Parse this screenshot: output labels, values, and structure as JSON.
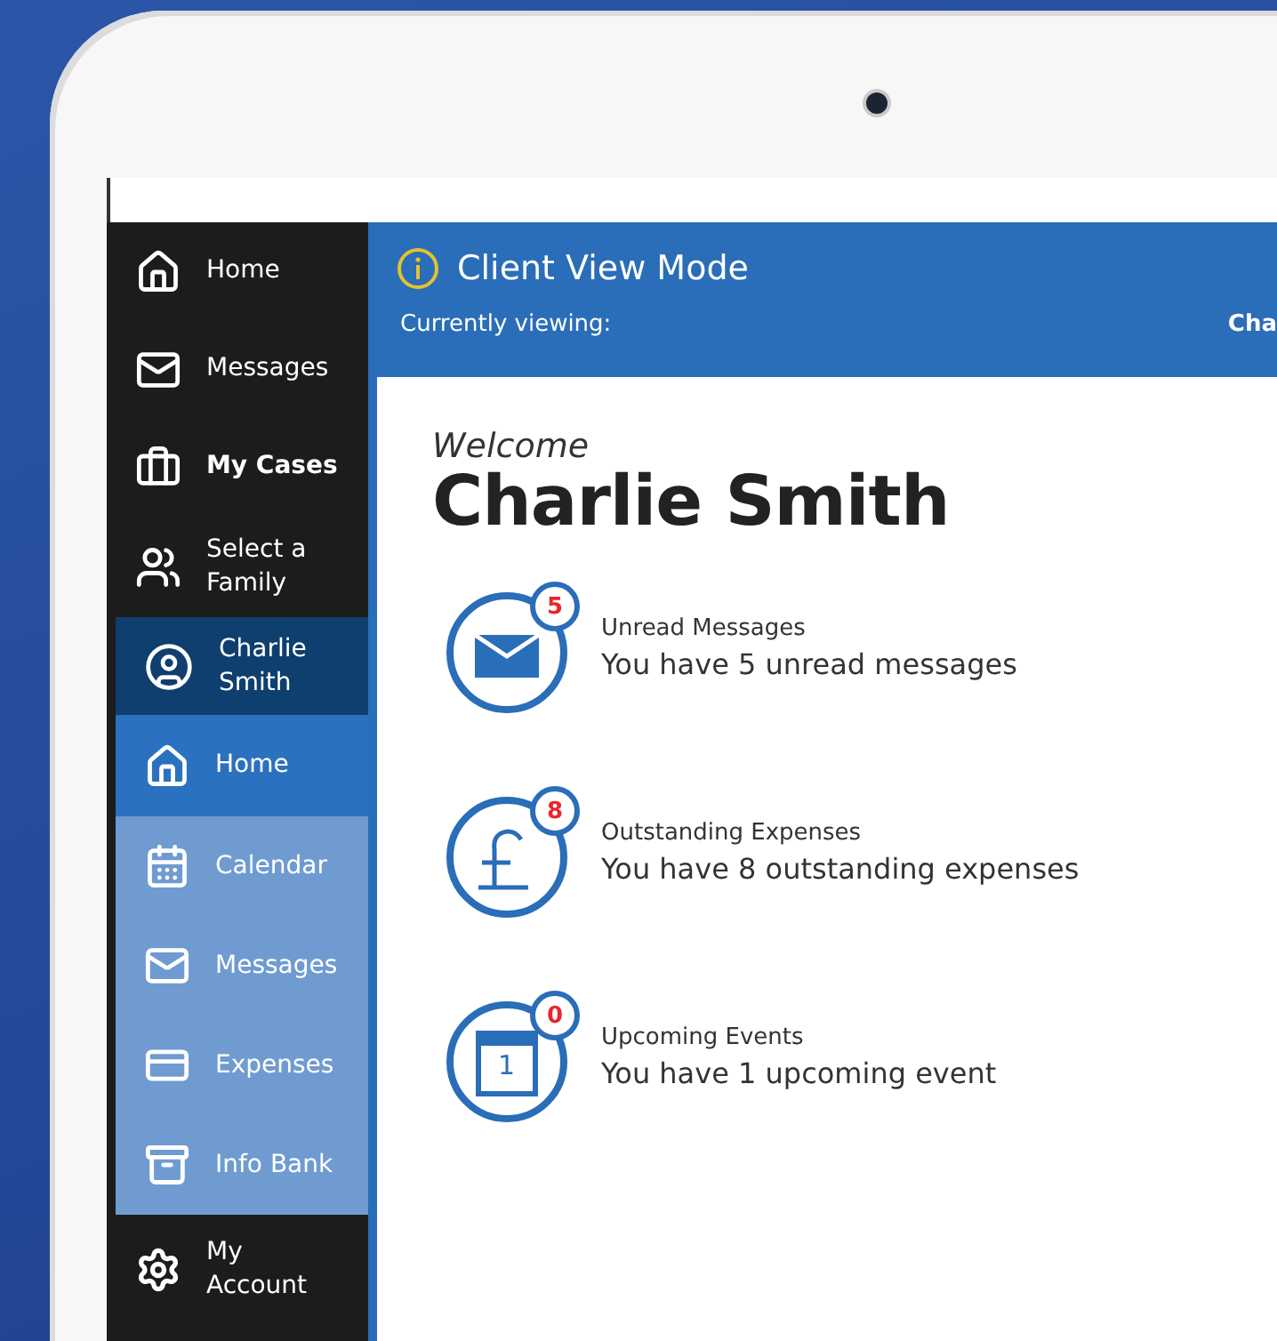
{
  "sidebar": {
    "main_items": [
      {
        "label": "Home",
        "kind": "home",
        "selected": false
      },
      {
        "label": "Messages",
        "kind": "mail",
        "selected": false
      },
      {
        "label": "My Cases",
        "kind": "briefcase",
        "selected": true
      },
      {
        "label": "Select a Family",
        "kind": "family",
        "selected": false
      }
    ],
    "client": {
      "name": "Charlie Smith"
    },
    "client_items": [
      {
        "label": "Home",
        "kind": "home",
        "selected": true
      },
      {
        "label": "Calendar",
        "kind": "calendar",
        "selected": false
      },
      {
        "label": "Messages",
        "kind": "mail",
        "selected": false
      },
      {
        "label": "Expenses",
        "kind": "card",
        "selected": false
      },
      {
        "label": "Info Bank",
        "kind": "cabinet",
        "selected": false
      }
    ],
    "account": {
      "label": "My Account"
    }
  },
  "header": {
    "title": "Client View Mode",
    "viewing_label": "Currently viewing:",
    "viewing_value": "Cha"
  },
  "welcome": {
    "greeting": "Welcome",
    "name": "Charlie Smith"
  },
  "stats": [
    {
      "kind": "messages",
      "badge": "5",
      "title": "Unread Messages",
      "text": "You have 5 unread messages"
    },
    {
      "kind": "expenses",
      "badge": "8",
      "title": "Outstanding Expenses",
      "text": "You have 8 outstanding expenses"
    },
    {
      "kind": "events",
      "badge": "0",
      "day": "1",
      "title": "Upcoming Events",
      "text": "You have 1 upcoming event"
    }
  ]
}
